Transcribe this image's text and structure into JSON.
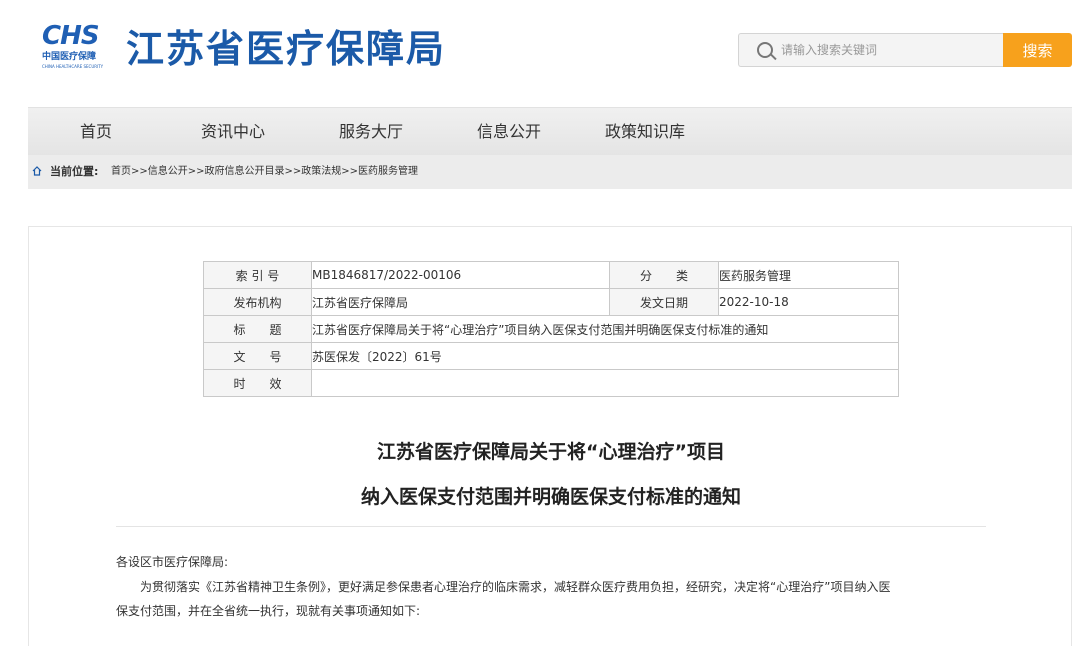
{
  "header": {
    "logo_abbr": "CHS",
    "logo_cn": "中国医疗保障",
    "logo_en": "CHINA HEALTHCARE SECURITY",
    "site_title": "江苏省医疗保障局",
    "search": {
      "placeholder": "请输入搜索关键词",
      "value": "",
      "button_label": "搜索",
      "icon": "search-icon"
    }
  },
  "nav": {
    "items": [
      {
        "label": "首页"
      },
      {
        "label": "资讯中心"
      },
      {
        "label": "服务大厅"
      },
      {
        "label": "信息公开"
      },
      {
        "label": "政策知识库"
      }
    ]
  },
  "breadcrumb": {
    "label": "当前位置:",
    "path": "首页>>信息公开>>政府信息公开目录>>政策法规>>医药服务管理",
    "icon": "home-icon"
  },
  "meta_table": {
    "index_label": "索 引 号",
    "index_value": "MB1846817/2022-00106",
    "category_label": "分　　类",
    "category_value": "医药服务管理",
    "issuer_label": "发布机构",
    "issuer_value": "江苏省医疗保障局",
    "date_label": "发文日期",
    "date_value": "2022-10-18",
    "title_label": "标　　题",
    "title_value": "江苏省医疗保障局关于将“心理治疗”项目纳入医保支付范围并明确医保支付标准的通知",
    "docno_label": "文　　号",
    "docno_value": "苏医保发〔2022〕61号",
    "validity_label": "时　　效",
    "validity_value": ""
  },
  "document": {
    "title_line1": "江苏省医疗保障局关于将“心理治疗”项目",
    "title_line2": "纳入医保支付范围并明确医保支付标准的通知",
    "salutation": "各设区市医疗保障局:",
    "para1_line1": "　　为贯彻落实《江苏省精神卫生条例》，更好满足参保患者心理治疗的临床需求，减轻群众医疗费用负担，经研究，决定将“心理治疗”项目纳入医",
    "para1_line2": "保支付范围，并在全省统一执行，现就有关事项通知如下:"
  },
  "colors": {
    "brand_blue": "#1b5aa8",
    "search_button": "#f7a11c"
  }
}
